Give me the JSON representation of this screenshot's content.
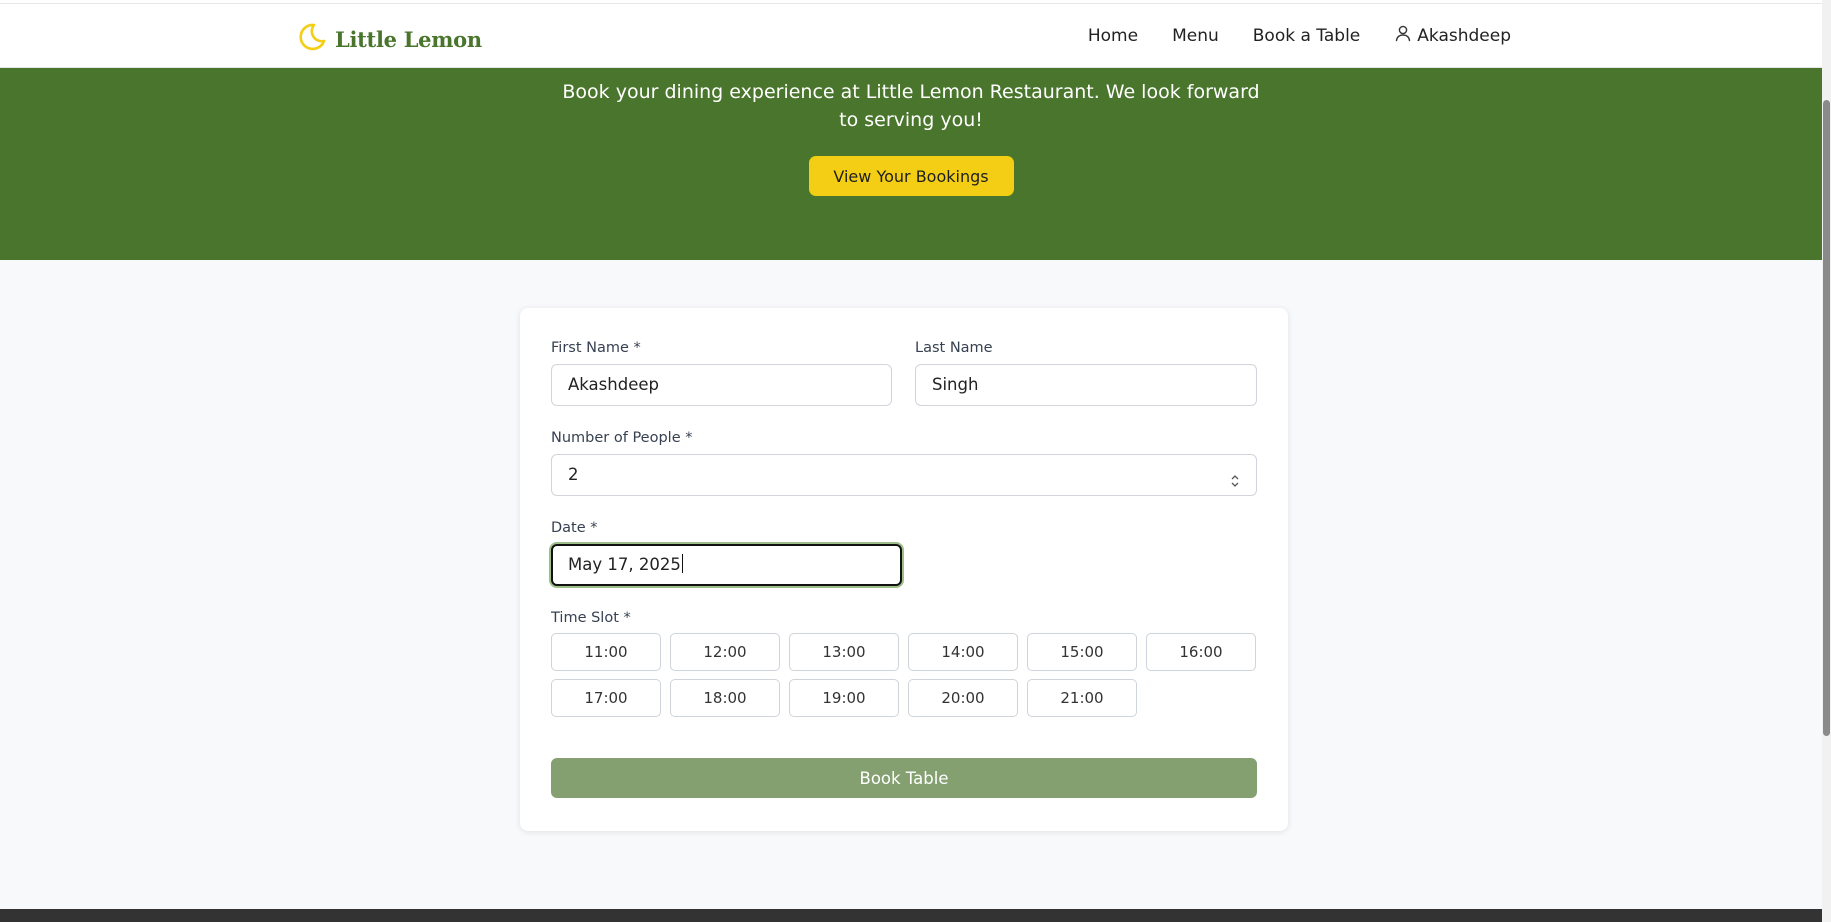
{
  "header": {
    "brand": "Little Lemon",
    "nav": [
      "Home",
      "Menu",
      "Book a Table"
    ],
    "user_name": "Akashdeep"
  },
  "hero": {
    "text": "Book your dining experience at Little Lemon Restaurant. We look forward to serving you!",
    "button": "View Your Bookings"
  },
  "form": {
    "first_name_label": "First Name *",
    "first_name_value": "Akashdeep",
    "last_name_label": "Last Name",
    "last_name_value": "Singh",
    "people_label": "Number of People *",
    "people_value": "2",
    "date_label": "Date *",
    "date_value": "May 17, 2025",
    "time_label": "Time Slot *",
    "time_slots": [
      "11:00",
      "12:00",
      "13:00",
      "14:00",
      "15:00",
      "16:00",
      "17:00",
      "18:00",
      "19:00",
      "20:00",
      "21:00"
    ],
    "submit": "Book Table"
  },
  "colors": {
    "brand_green": "#4a752c",
    "brand_yellow": "#f4ce14",
    "button_green_disabled": "#84a070",
    "footer_dark": "#333333"
  },
  "icons": {
    "logo": "crescent-moon-icon",
    "user": "user-icon",
    "spinner": "number-spinner-icon"
  }
}
